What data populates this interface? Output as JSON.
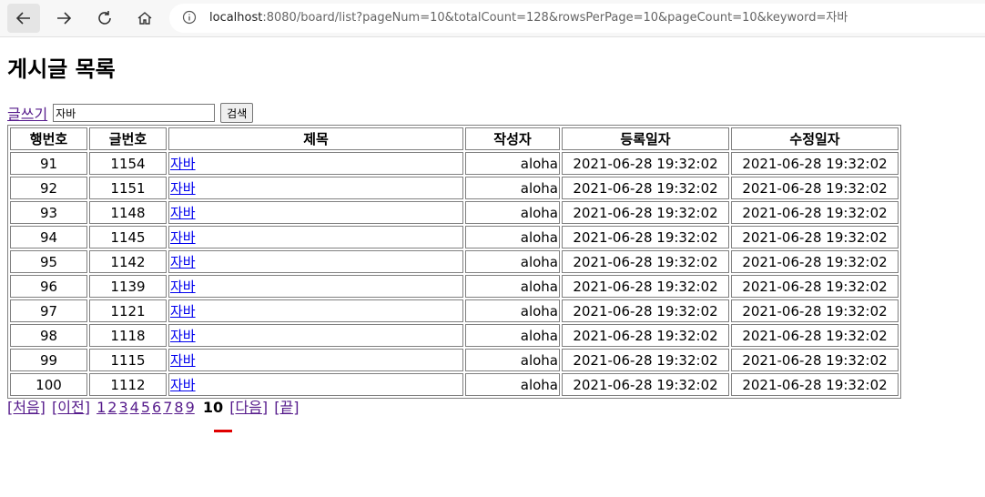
{
  "browser": {
    "url_host": "localhost",
    "url_rest": ":8080/board/list?pageNum=10&totalCount=128&rowsPerPage=10&pageCount=10&keyword=자바"
  },
  "page": {
    "title": "게시글 목록",
    "write_link": "글쓰기",
    "search_value": "자바",
    "search_button": "검색"
  },
  "table": {
    "headers": [
      "행번호",
      "글번호",
      "제목",
      "작성자",
      "등록일자",
      "수정일자"
    ],
    "rows": [
      {
        "row_no": "91",
        "post_no": "1154",
        "title": "자바",
        "writer": "aloha",
        "created": "2021-06-28 19:32:02",
        "modified": "2021-06-28 19:32:02"
      },
      {
        "row_no": "92",
        "post_no": "1151",
        "title": "자바",
        "writer": "aloha",
        "created": "2021-06-28 19:32:02",
        "modified": "2021-06-28 19:32:02"
      },
      {
        "row_no": "93",
        "post_no": "1148",
        "title": "자바",
        "writer": "aloha",
        "created": "2021-06-28 19:32:02",
        "modified": "2021-06-28 19:32:02"
      },
      {
        "row_no": "94",
        "post_no": "1145",
        "title": "자바",
        "writer": "aloha",
        "created": "2021-06-28 19:32:02",
        "modified": "2021-06-28 19:32:02"
      },
      {
        "row_no": "95",
        "post_no": "1142",
        "title": "자바",
        "writer": "aloha",
        "created": "2021-06-28 19:32:02",
        "modified": "2021-06-28 19:32:02"
      },
      {
        "row_no": "96",
        "post_no": "1139",
        "title": "자바",
        "writer": "aloha",
        "created": "2021-06-28 19:32:02",
        "modified": "2021-06-28 19:32:02"
      },
      {
        "row_no": "97",
        "post_no": "1121",
        "title": "자바",
        "writer": "aloha",
        "created": "2021-06-28 19:32:02",
        "modified": "2021-06-28 19:32:02"
      },
      {
        "row_no": "98",
        "post_no": "1118",
        "title": "자바",
        "writer": "aloha",
        "created": "2021-06-28 19:32:02",
        "modified": "2021-06-28 19:32:02"
      },
      {
        "row_no": "99",
        "post_no": "1115",
        "title": "자바",
        "writer": "aloha",
        "created": "2021-06-28 19:32:02",
        "modified": "2021-06-28 19:32:02"
      },
      {
        "row_no": "100",
        "post_no": "1112",
        "title": "자바",
        "writer": "aloha",
        "created": "2021-06-28 19:32:02",
        "modified": "2021-06-28 19:32:02"
      }
    ]
  },
  "pager": {
    "first": "[처음]",
    "prev": "[이전]",
    "pages": [
      "1",
      "2",
      "3",
      "4",
      "5",
      "6",
      "7",
      "8",
      "9"
    ],
    "current": "10",
    "next": "[다음]",
    "last": "[끝]"
  },
  "colors": {
    "visited_link": "#551a8b",
    "link": "#0000ee",
    "marker": "#e00000"
  }
}
